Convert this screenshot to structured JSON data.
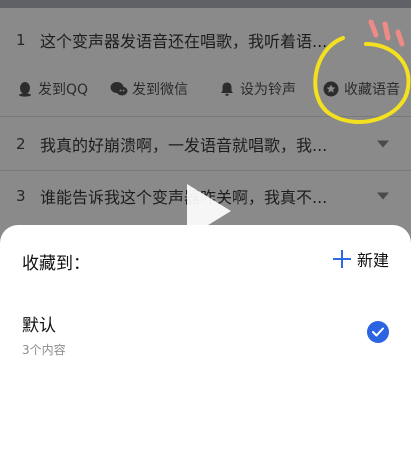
{
  "list": {
    "rows": [
      {
        "num": "1",
        "title": "这个变声器发语音还在唱歌，我听着语..."
      },
      {
        "num": "2",
        "title": "我真的好崩溃啊，一发语音就唱歌，我..."
      },
      {
        "num": "3",
        "title": "谁能告诉我这个变声器咋关啊，我真不..."
      }
    ],
    "actions": [
      {
        "label": "发到QQ",
        "icon": "qq-icon"
      },
      {
        "label": "发到微信",
        "icon": "wechat-icon"
      },
      {
        "label": "设为铃声",
        "icon": "bell-icon"
      },
      {
        "label": "收藏语音",
        "icon": "star-icon"
      }
    ]
  },
  "sheet": {
    "title": "收藏到：",
    "new_label": "新建",
    "folders": [
      {
        "name": "默认",
        "count": "3个内容",
        "selected": true
      }
    ]
  },
  "colors": {
    "accent": "#2b63e0",
    "highlight": "#f3e01f",
    "overlay": "#8a8a8a"
  }
}
